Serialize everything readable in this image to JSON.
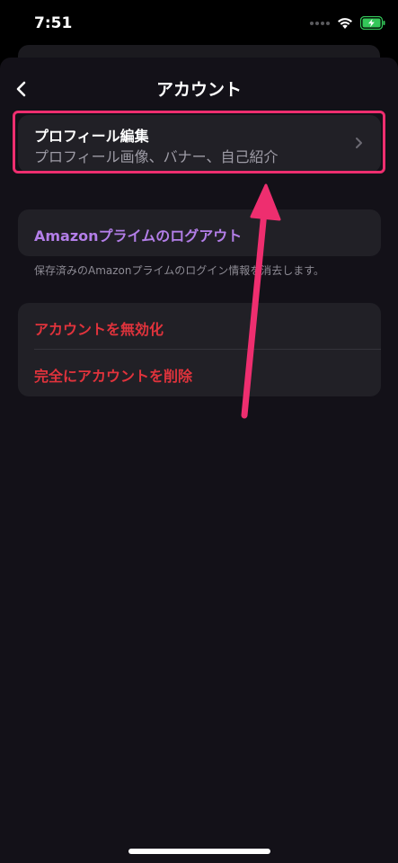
{
  "status_bar": {
    "time": "7:51",
    "wifi_icon": "wifi-icon",
    "battery_icon": "battery-charging-icon",
    "battery_color": "#34c759"
  },
  "nav": {
    "title": "アカウント",
    "back_icon": "chevron-left-icon"
  },
  "profile": {
    "title": "プロフィール編集",
    "subtitle": "プロフィール画像、バナー、自己紹介",
    "chevron_icon": "chevron-right-icon"
  },
  "amazon": {
    "label": "Amazonプライムのログアウト",
    "note": "保存済みのAmazonプライムのログイン情報を消去します。",
    "color": "#b37ee8"
  },
  "danger": {
    "deactivate": "アカウントを無効化",
    "delete": "完全にアカウントを削除",
    "color": "#e0333c"
  },
  "annotation": {
    "highlight_color": "#ee2e6f"
  }
}
